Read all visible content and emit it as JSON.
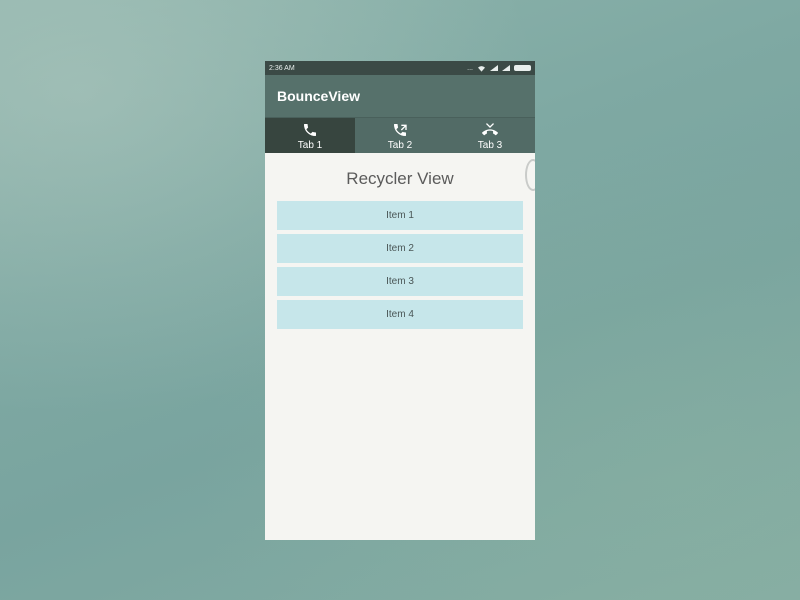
{
  "status_bar": {
    "time": "2:36 AM",
    "dots": "..."
  },
  "app_bar": {
    "title": "BounceView"
  },
  "tabs": [
    {
      "label": "Tab 1",
      "icon": "phone-icon",
      "active": true
    },
    {
      "label": "Tab 2",
      "icon": "call-forward-icon",
      "active": false
    },
    {
      "label": "Tab 3",
      "icon": "call-end-icon",
      "active": false
    }
  ],
  "content": {
    "title": "Recycler View",
    "items": [
      {
        "label": "Item 1"
      },
      {
        "label": "Item 2"
      },
      {
        "label": "Item 3"
      },
      {
        "label": "Item 4"
      }
    ]
  },
  "colors": {
    "app_bar": "#56716b",
    "tab_bar": "#526b66",
    "tab_active": "#37453f",
    "list_item": "#c6e6ea",
    "content_bg": "#f5f5f2"
  }
}
